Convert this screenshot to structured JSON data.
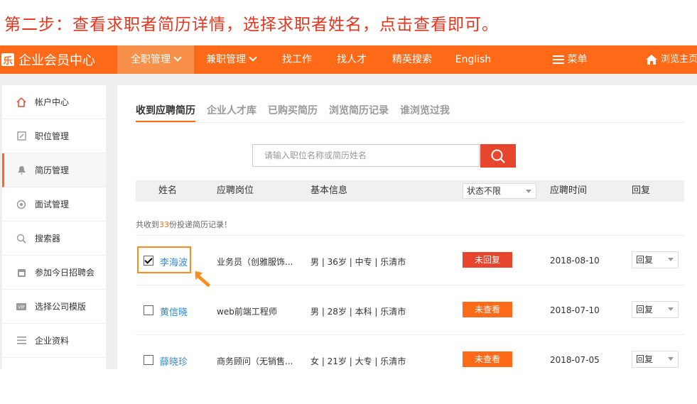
{
  "instruction": "第二步：查看求职者简历详情，选择求职者姓名，点击查看即可。",
  "colors": {
    "brand": "#ff6a19",
    "unreplied": "#e8452f",
    "unviewed": "#ff6a19",
    "link": "#2f8bd8"
  },
  "topbar": {
    "logo": "乐",
    "title": "企业会员中心",
    "nav": [
      {
        "label": "全职管理",
        "dropdown": true,
        "active": true
      },
      {
        "label": "兼职管理",
        "dropdown": true,
        "active": false
      },
      {
        "label": "找工作"
      },
      {
        "label": "找人才"
      },
      {
        "label": "精英搜索"
      },
      {
        "label": "English"
      }
    ],
    "menu": "菜单",
    "browse_home": "浏览主页"
  },
  "sidebar": {
    "items": [
      {
        "label": "帐户中心",
        "icon": "home-icon"
      },
      {
        "label": "职位管理",
        "icon": "edit-icon"
      },
      {
        "label": "简历管理",
        "icon": "bell-icon",
        "active": true
      },
      {
        "label": "面试管理",
        "icon": "gear-icon"
      },
      {
        "label": "搜索器",
        "icon": "search-icon"
      },
      {
        "label": "参加今日招聘会",
        "icon": "calendar-icon"
      },
      {
        "label": "选择公司模版",
        "icon": "vip-icon"
      },
      {
        "label": "企业资料",
        "icon": "list-icon"
      }
    ]
  },
  "tabs": [
    "收到应聘简历",
    "企业人才库",
    "已购买简历",
    "浏览简历记录",
    "谁浏览过我"
  ],
  "search": {
    "placeholder": "请输入职位名称或简历姓名"
  },
  "table": {
    "headers": {
      "name": "姓名",
      "position": "应聘岗位",
      "info": "基本信息",
      "status_filter": "状态不限",
      "time": "应聘时间",
      "reply": "回复"
    },
    "count_prefix": "共收到",
    "count": "33",
    "count_suffix": "份投递简历记录！",
    "rows": [
      {
        "name": "李海波",
        "position": "业务员（创雅服饰...",
        "info": "男 | 36岁 | 中专 | 乐清市",
        "status": "未回复",
        "time": "2018-08-10",
        "reply": "回复",
        "checked": true
      },
      {
        "name": "黄信晓",
        "position": "web前端工程师",
        "info": "男 | 28岁 | 本科 | 乐清市",
        "status": "未查看",
        "time": "2018-07-10",
        "reply": "回复",
        "checked": false
      },
      {
        "name": "薛晓珍",
        "position": "商务顾问（无销售...",
        "info": "女 | 21岁 | 大专 | 乐清市",
        "status": "未查看",
        "time": "2018-07-05",
        "reply": "回复",
        "checked": false
      }
    ]
  }
}
